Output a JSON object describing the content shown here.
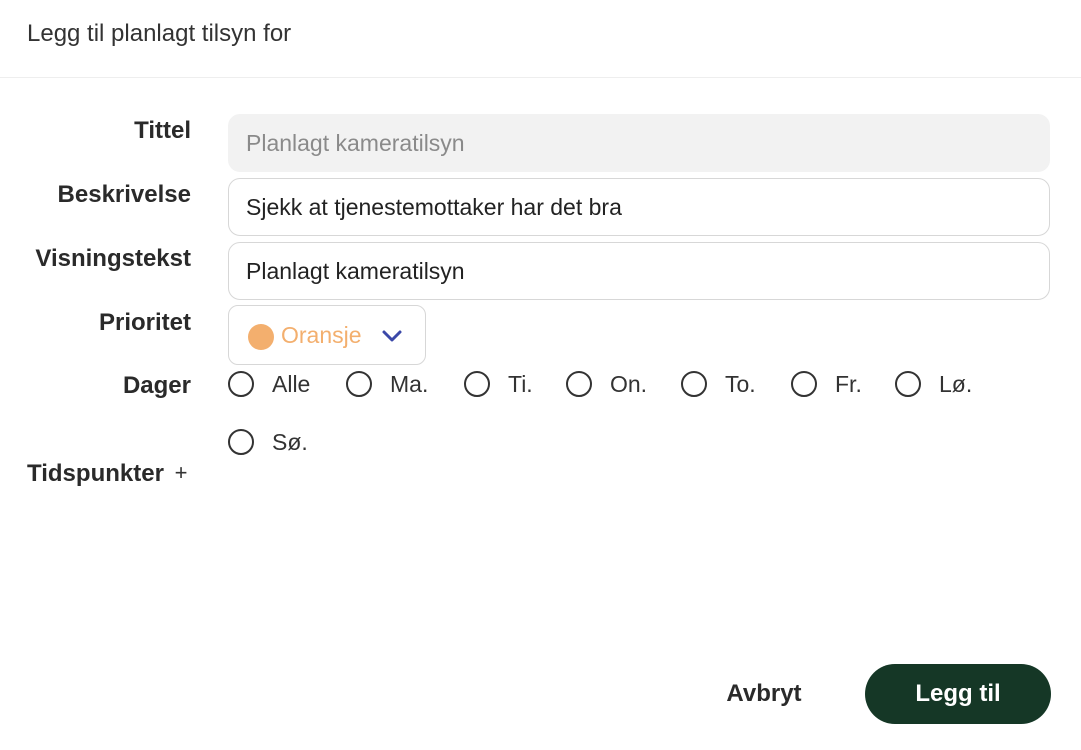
{
  "dialog": {
    "title": "Legg til planlagt tilsyn for"
  },
  "form": {
    "title": {
      "label": "Tittel",
      "value": "Planlagt kameratilsyn"
    },
    "description": {
      "label": "Beskrivelse",
      "value": "Sjekk at tjenestemottaker har det bra"
    },
    "display_text": {
      "label": "Visningstekst",
      "value": "Planlagt kameratilsyn"
    },
    "priority": {
      "label": "Prioritet",
      "value": "Oransje",
      "color": "#f3af6e",
      "chevron_color": "#3b48a8"
    },
    "days": {
      "label": "Dager",
      "options": [
        "Alle",
        "Ma.",
        "Ti.",
        "On.",
        "To.",
        "Fr.",
        "Lø.",
        "Sø."
      ]
    },
    "times": {
      "label": "Tidspunkter",
      "add_symbol": "+"
    }
  },
  "actions": {
    "cancel_label": "Avbryt",
    "submit_label": "Legg til",
    "submit_color": "#153726"
  }
}
